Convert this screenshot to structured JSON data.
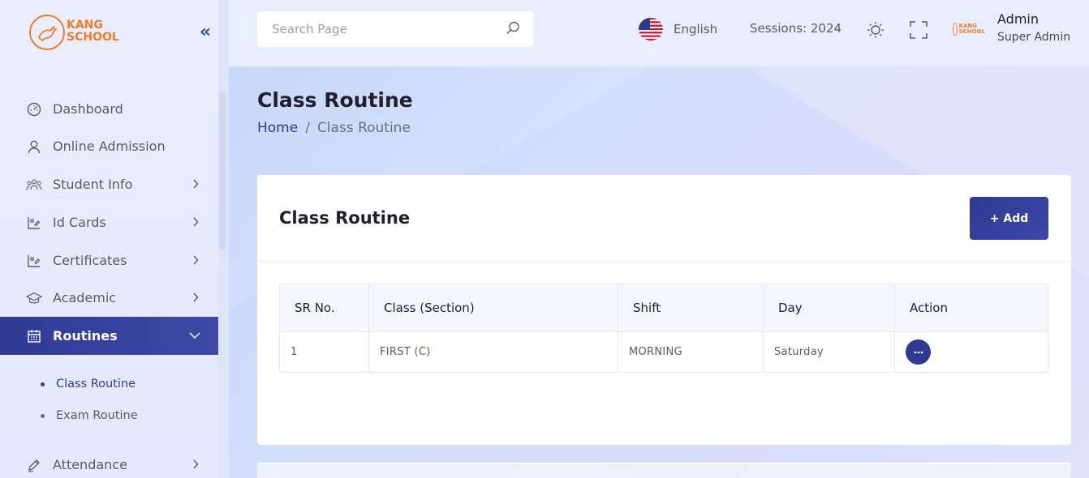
{
  "logo": {
    "line1": "KANG",
    "line2": "SCHOOL"
  },
  "sidebar": {
    "items": [
      {
        "label": "Dashboard",
        "icon": "speedometer-icon"
      },
      {
        "label": "Online Admission",
        "icon": "user-icon"
      },
      {
        "label": "Student Info",
        "icon": "users-icon"
      },
      {
        "label": "Id Cards",
        "icon": "card-icon"
      },
      {
        "label": "Certificates",
        "icon": "certificate-icon"
      },
      {
        "label": "Academic",
        "icon": "graduation-cap-icon"
      },
      {
        "label": "Routines",
        "icon": "calendar-icon"
      },
      {
        "label": "Attendance",
        "icon": "pen-icon"
      }
    ],
    "routines_sub": [
      {
        "label": "Class Routine"
      },
      {
        "label": "Exam Routine"
      }
    ]
  },
  "header": {
    "search_placeholder": "Search Page",
    "language": "English",
    "session": "Sessions: 2024",
    "user_name": "Admin",
    "user_role": "Super Admin"
  },
  "page": {
    "title": "Class Routine",
    "breadcrumb_home": "Home",
    "breadcrumb_sep": "/",
    "breadcrumb_current": "Class Routine"
  },
  "card": {
    "title": "Class Routine",
    "add_label": "+ Add",
    "columns": [
      "SR No.",
      "Class (Section)",
      "Shift",
      "Day",
      "Action"
    ],
    "rows": [
      {
        "sr": "1",
        "class_section": "FIRST (C)",
        "shift": "MORNING",
        "day": "Saturday"
      }
    ]
  },
  "colors": {
    "primary": "#2f3a94",
    "brand_orange": "#f07b2b",
    "sidebar_bg": "#eaeefc"
  }
}
